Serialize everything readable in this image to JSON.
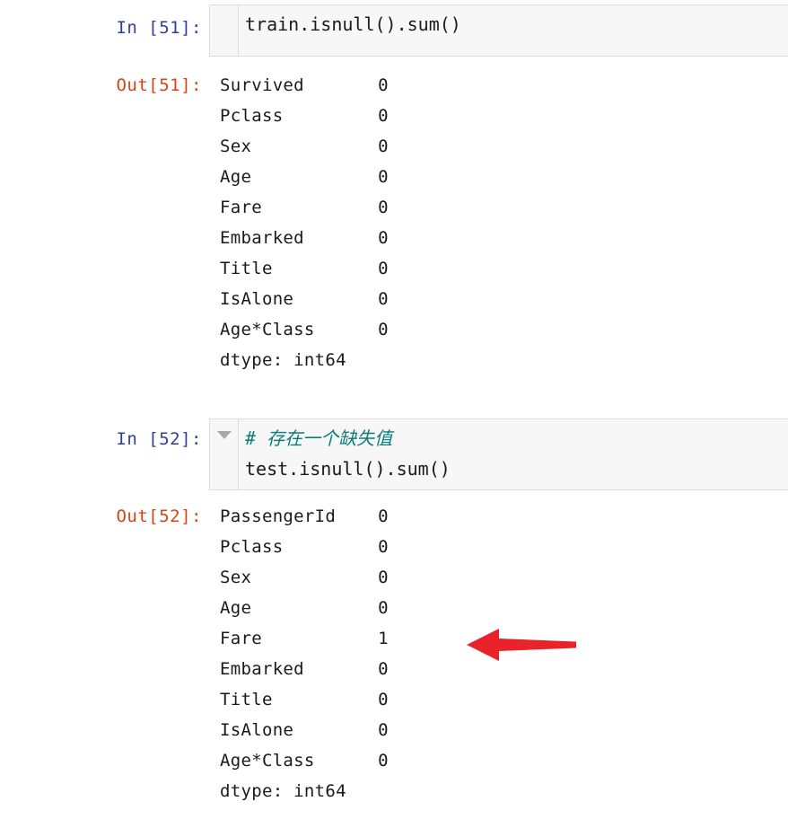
{
  "notebook": {
    "background_color": "#ffffff",
    "prompt_in_color": "#303f9f",
    "prompt_out_color": "#d84315",
    "comment_color": "#0b7c7c",
    "annotation_color": "#e8242a",
    "cells": [
      {
        "prompt_in": "In [51]:",
        "prompt_out": "Out[51]:",
        "has_collapse_triangle": false,
        "code_comment": "",
        "code_line": "train.isnull().sum()",
        "output_text": "Survived       0\nPclass         0\nSex            0\nAge            0\nFare           0\nEmbarked       0\nTitle          0\nIsAlone        0\nAge*Class      0\ndtype: int64",
        "output_rows": [
          {
            "name": "Survived",
            "value": "0"
          },
          {
            "name": "Pclass",
            "value": "0"
          },
          {
            "name": "Sex",
            "value": "0"
          },
          {
            "name": "Age",
            "value": "0"
          },
          {
            "name": "Fare",
            "value": "0"
          },
          {
            "name": "Embarked",
            "value": "0"
          },
          {
            "name": "Title",
            "value": "0"
          },
          {
            "name": "IsAlone",
            "value": "0"
          },
          {
            "name": "Age*Class",
            "value": "0"
          }
        ],
        "output_dtype": "dtype: int64"
      },
      {
        "prompt_in": "In [52]:",
        "prompt_out": "Out[52]:",
        "has_collapse_triangle": true,
        "collapse_icon": "chevron-down-icon",
        "code_comment": "# 存在一个缺失值",
        "code_line": "test.isnull().sum()",
        "output_text": "PassengerId    0\nPclass         0\nSex            0\nAge            0\nFare           1\nEmbarked       0\nTitle          0\nIsAlone        0\nAge*Class      0\ndtype: int64",
        "output_rows": [
          {
            "name": "PassengerId",
            "value": "0"
          },
          {
            "name": "Pclass",
            "value": "0"
          },
          {
            "name": "Sex",
            "value": "0"
          },
          {
            "name": "Age",
            "value": "0"
          },
          {
            "name": "Fare",
            "value": "1"
          },
          {
            "name": "Embarked",
            "value": "0"
          },
          {
            "name": "Title",
            "value": "0"
          },
          {
            "name": "IsAlone",
            "value": "0"
          },
          {
            "name": "Age*Class",
            "value": "0"
          }
        ],
        "output_dtype": "dtype: int64"
      }
    ],
    "annotation": {
      "type": "arrow",
      "direction": "left",
      "points_at": "Fare value 1 in Out[52]",
      "color": "#e8242a"
    }
  }
}
